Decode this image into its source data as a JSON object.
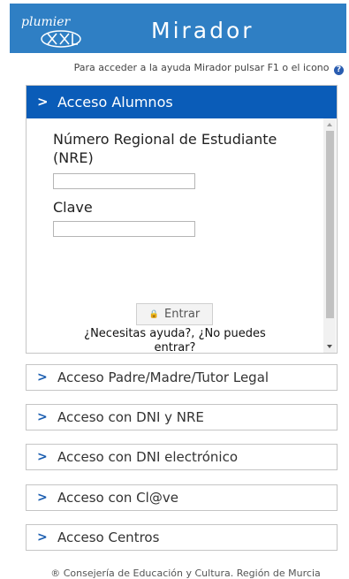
{
  "header": {
    "logo_text": "plumier",
    "title": "Mirador",
    "background": "#2f7fc4"
  },
  "help": {
    "text": "Para acceder a la ayuda Mirador pulsar F1 o el icono",
    "icon_label": "?",
    "icon": "help-circle-icon"
  },
  "login_panel": {
    "chevron": ">",
    "title": "Acceso Alumnos",
    "nre_label_line1": "Número Regional de Estudiante",
    "nre_label_line2": "(NRE)",
    "nre_value": "",
    "password_label": "Clave",
    "password_value": "",
    "lock_icon": "lock-icon",
    "submit_label": "Entrar",
    "help_line1": "¿Necesitas ayuda?, ¿No puedes",
    "help_line2": "entrar?",
    "bar_color": "#0a5cb8"
  },
  "accordion": [
    {
      "chevron": ">",
      "label": "Acceso Padre/Madre/Tutor Legal"
    },
    {
      "chevron": ">",
      "label": "Acceso con DNI y NRE"
    },
    {
      "chevron": ">",
      "label": "Acceso con DNI electrónico"
    },
    {
      "chevron": ">",
      "label": "Acceso con Cl@ve"
    },
    {
      "chevron": ">",
      "label": "Acceso Centros"
    }
  ],
  "footer": {
    "text": "® Consejería de Educación y Cultura. Región de Murcia"
  }
}
